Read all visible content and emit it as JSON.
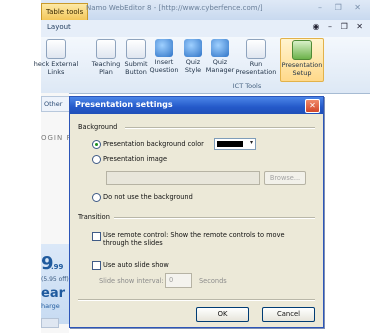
{
  "window": {
    "context_tab": "Table tools",
    "title": "Namo WebEditor 8 - [http://www.cyberfence.com/]",
    "controls": "– ❐ ✕",
    "ribbon_tab": "Layout",
    "ribbon_right_controls": "◉ – ❐ ✕"
  },
  "ribbon": {
    "buttons": [
      {
        "label": "heck External\nLinks"
      },
      {
        "label": "Teaching\nPlan"
      },
      {
        "label": "Submit\nButton"
      },
      {
        "label": "Insert\nQuestion"
      },
      {
        "label": "Quiz\nStyle"
      },
      {
        "label": "Quiz\nManager"
      },
      {
        "label": "Run\nPresentation"
      },
      {
        "label": "Presentation\nSetup"
      }
    ],
    "group_label": "ICT Tools"
  },
  "background": {
    "doc_tab": "Other",
    "login_fragment": "OGIN R",
    "price_big": "9",
    "price_cents": ".99",
    "price_sub": "(5.95 off)",
    "price_year": "ear",
    "price_charge": "harge"
  },
  "dialog": {
    "title": "Presentation settings",
    "close_glyph": "✕",
    "background_section": "Background",
    "opt_bg_color": "Presentation background color",
    "opt_bg_image": "Presentation image",
    "browse_label": "Browse...",
    "opt_no_bg": "Do not use the background",
    "transition_section": "Transition",
    "remote_control_label": "Use remote control: Show the remote controls to move through the slides",
    "auto_slide_label": "Use auto slide show",
    "interval_label": "Slide show interval:",
    "interval_value": "0",
    "interval_unit": "Seconds",
    "ok_label": "OK",
    "cancel_label": "Cancel",
    "selected_color": "#000000"
  }
}
